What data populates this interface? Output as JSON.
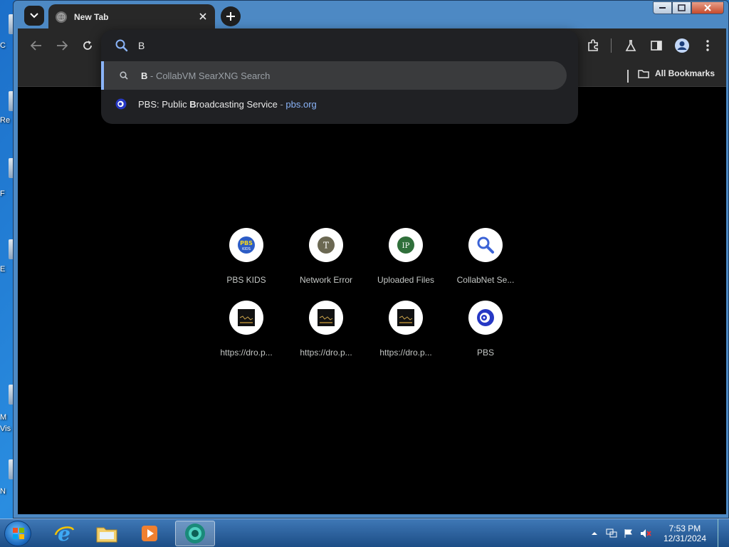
{
  "desktop": {
    "icon_labels": [
      "C",
      "Re",
      "F",
      "E",
      "M",
      "Vis",
      "N"
    ]
  },
  "window": {
    "controls": [
      "minimize",
      "maximize",
      "close"
    ]
  },
  "tab": {
    "title": "New Tab"
  },
  "omnibox": {
    "value": "B",
    "suggestions": [
      {
        "bold": "B",
        "rest": " - CollabVM SearXNG Search",
        "url": ""
      },
      {
        "pre": "PBS: Public ",
        "bold": "B",
        "rest": "roadcasting Service",
        "sep": " - ",
        "url": "pbs.org"
      }
    ]
  },
  "bookmarks": {
    "all_label": "All Bookmarks"
  },
  "shortcuts": [
    {
      "label": "PBS KIDS",
      "icon": "pbs-kids-logo"
    },
    {
      "label": "Network Error",
      "icon": "letter-T",
      "letter": "T"
    },
    {
      "label": "Uploaded Files",
      "icon": "letter-IP",
      "letter": "IP"
    },
    {
      "label": "CollabNet Se...",
      "icon": "search-icon"
    },
    {
      "label": "https://dro.p...",
      "icon": "thumbnail"
    },
    {
      "label": "https://dro.p...",
      "icon": "thumbnail"
    },
    {
      "label": "https://dro.p...",
      "icon": "thumbnail"
    },
    {
      "label": "PBS",
      "icon": "pbs-logo"
    }
  ],
  "taskbar": {
    "clock_time": "7:53 PM",
    "clock_date": "12/31/2024"
  },
  "colors": {
    "accent": "#8ab4f8",
    "chrome_dark": "#282828",
    "page_bg": "#000000"
  }
}
